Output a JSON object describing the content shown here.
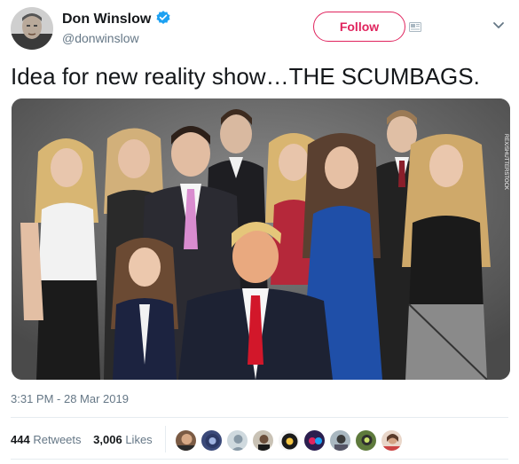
{
  "author": {
    "name": "Don Winslow",
    "handle": "@donwinslow",
    "verified": true
  },
  "header": {
    "follow_label": "Follow"
  },
  "tweet": {
    "text": "Idea for new reality show…THE SCUMBAGS.",
    "timestamp": "3:31 PM - 28 Mar 2019"
  },
  "stats": {
    "retweets_count": "444",
    "retweets_label": "Retweets",
    "likes_count": "3,006",
    "likes_label": "Likes"
  },
  "photo": {
    "watermark": "REX/SHUTTERSTOCK"
  },
  "colors": {
    "accent": "#e0245e",
    "verified": "#1da1f2",
    "muted_text": "#657786",
    "primary_text": "#14171a",
    "divider": "#e6ecf0"
  },
  "icons": [
    "verified-badge-icon",
    "card-icon",
    "chevron-down-icon"
  ],
  "likers_count_shown": 9
}
